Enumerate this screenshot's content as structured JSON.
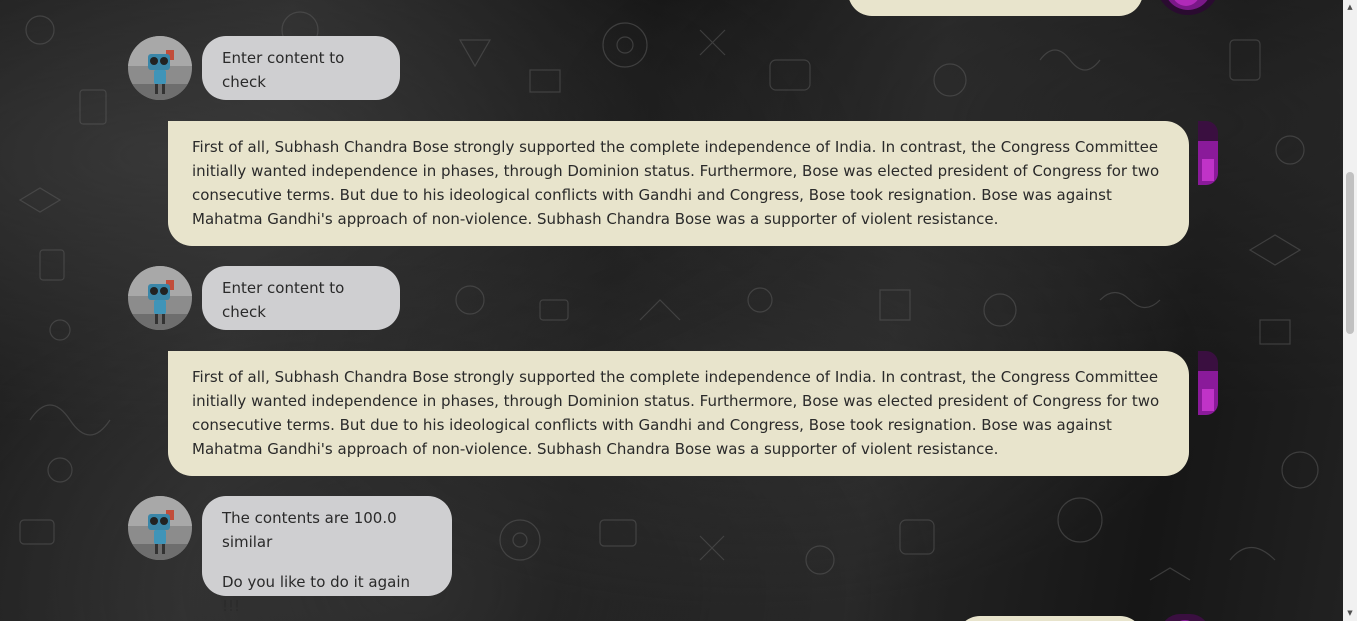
{
  "chat": {
    "messages": [
      {
        "role": "user",
        "text": ""
      },
      {
        "role": "bot",
        "text": "Enter content to check"
      },
      {
        "role": "user",
        "text": "First of all, Subhash Chandra Bose strongly supported the complete independence of India. In contrast, the Congress Committee initially wanted independence in phases, through Dominion status. Furthermore, Bose was elected president of Congress for two consecutive terms. But due to his ideological conflicts with Gandhi and Congress, Bose took resignation. Bose was against Mahatma Gandhi's approach of non-violence. Subhash Chandra Bose was a supporter of violent resistance."
      },
      {
        "role": "bot",
        "text": "Enter content to check"
      },
      {
        "role": "user",
        "text": "First of all, Subhash Chandra Bose strongly supported the complete independence of India. In contrast, the Congress Committee initially wanted independence in phases, through Dominion status. Furthermore, Bose was elected president of Congress for two consecutive terms. But due to his ideological conflicts with Gandhi and Congress, Bose took resignation. Bose was against Mahatma Gandhi's approach of non-violence. Subhash Chandra Bose was a supporter of violent resistance."
      },
      {
        "role": "bot",
        "lines": [
          "The contents are 100.0 similar",
          "Do you like to do it again !!!"
        ]
      },
      {
        "role": "user",
        "text": ""
      }
    ]
  },
  "icons": {
    "bot_avatar": "robot-avatar-icon",
    "user_avatar": "user-avatar-icon",
    "scroll_up": "chevron-up-icon",
    "scroll_down": "chevron-down-icon"
  },
  "colors": {
    "bot_bubble": "#cfcfd1",
    "user_bubble": "#e8e4cc",
    "user_avatar_accent": "#8a1a9a"
  }
}
